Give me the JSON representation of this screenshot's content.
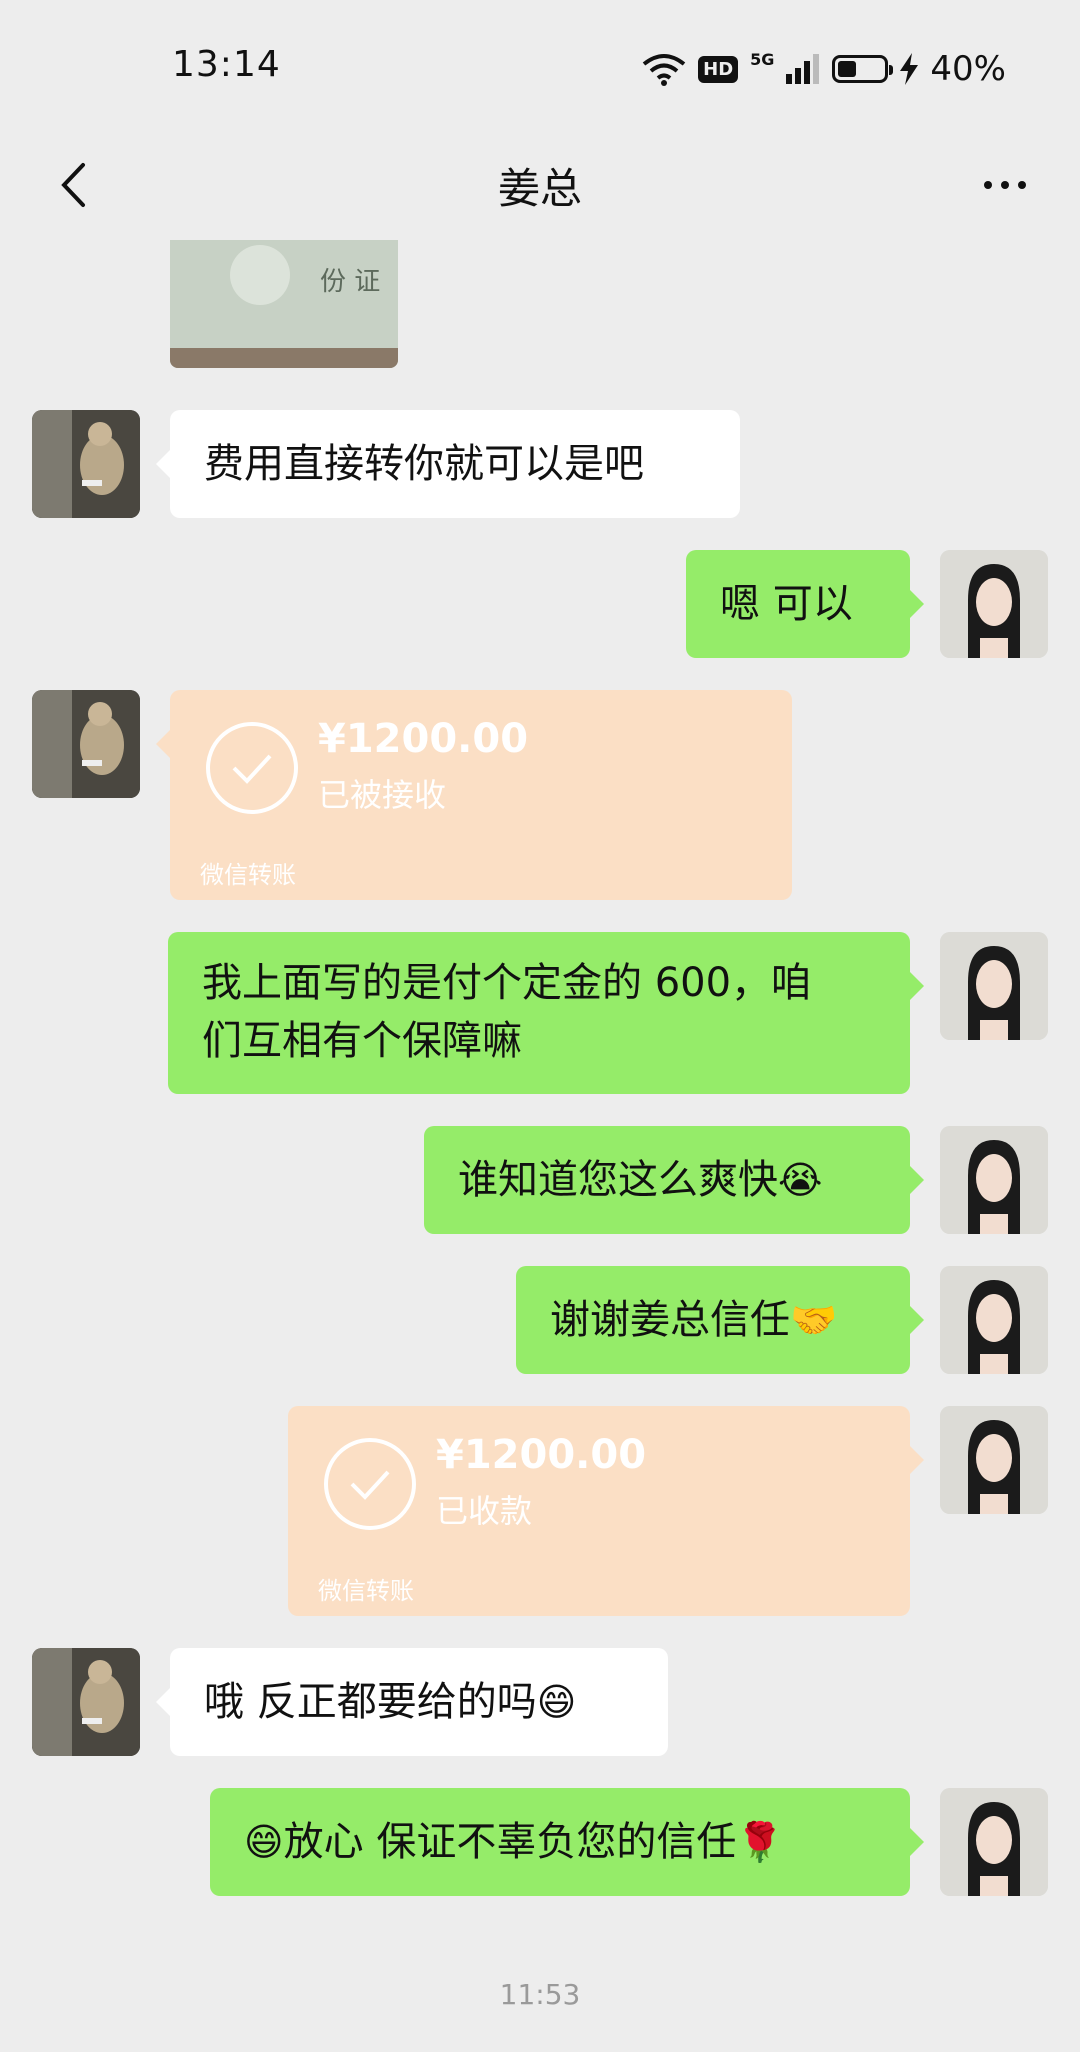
{
  "status_bar": {
    "time": "13:14",
    "network": "5G",
    "hd": "HD",
    "battery": "40%",
    "battery_level": 0.4
  },
  "nav": {
    "title": "姜总",
    "back_icon": "chevron-left-icon",
    "more_icon": "more-dots-icon"
  },
  "messages": [
    {
      "type": "image",
      "from": "contact",
      "content": "id-card-photo"
    },
    {
      "type": "text",
      "from": "contact",
      "text": "费用直接转你就可以是吧"
    },
    {
      "type": "text",
      "from": "me",
      "text": "嗯  可以"
    },
    {
      "type": "transfer",
      "from": "contact",
      "amount": "¥1200.00",
      "status": "已被接收",
      "footer": "微信转账"
    },
    {
      "type": "text",
      "from": "me",
      "line1": "我上面写的是付个定金的 600，咱",
      "line2": "们互相有个保障嘛"
    },
    {
      "type": "text",
      "from": "me",
      "text": "谁知道您这么爽快",
      "emoji": "😭"
    },
    {
      "type": "text",
      "from": "me",
      "text": "谢谢姜总信任",
      "emoji": "🤝"
    },
    {
      "type": "transfer",
      "from": "me",
      "amount": "¥1200.00",
      "status": "已收款",
      "footer": "微信转账"
    },
    {
      "type": "text",
      "from": "contact",
      "text": "哦 反正都要给的吗",
      "emoji": "😄"
    },
    {
      "type": "text",
      "from": "me",
      "emoji_lead": "😄",
      "text": "放心  保证不辜负您的信任",
      "emoji": "🌹"
    }
  ],
  "timestamp": "11:53"
}
